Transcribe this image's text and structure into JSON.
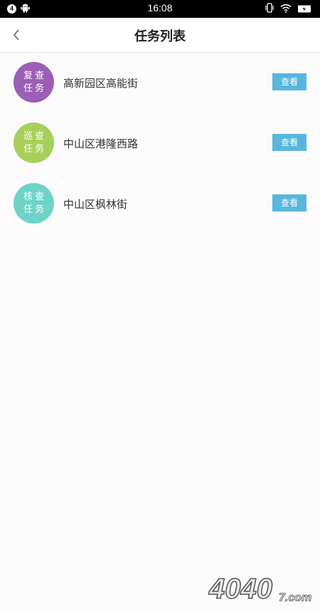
{
  "status_bar": {
    "notification_count": "4",
    "time": "16:08"
  },
  "header": {
    "title": "任务列表"
  },
  "tasks": [
    {
      "type_line1": "复查",
      "type_line2": "任务",
      "address": "高新园区高能街",
      "action": "查看",
      "color": "#9b5fb6"
    },
    {
      "type_line1": "巡查",
      "type_line2": "任务",
      "address": "中山区港隆西路",
      "action": "查看",
      "color": "#a8cf5c"
    },
    {
      "type_line1": "核查",
      "type_line2": "任务",
      "address": "中山区枫林街",
      "action": "查看",
      "color": "#6ed3c7"
    }
  ],
  "watermark": {
    "main": "4040",
    "suffix": "7.com"
  }
}
